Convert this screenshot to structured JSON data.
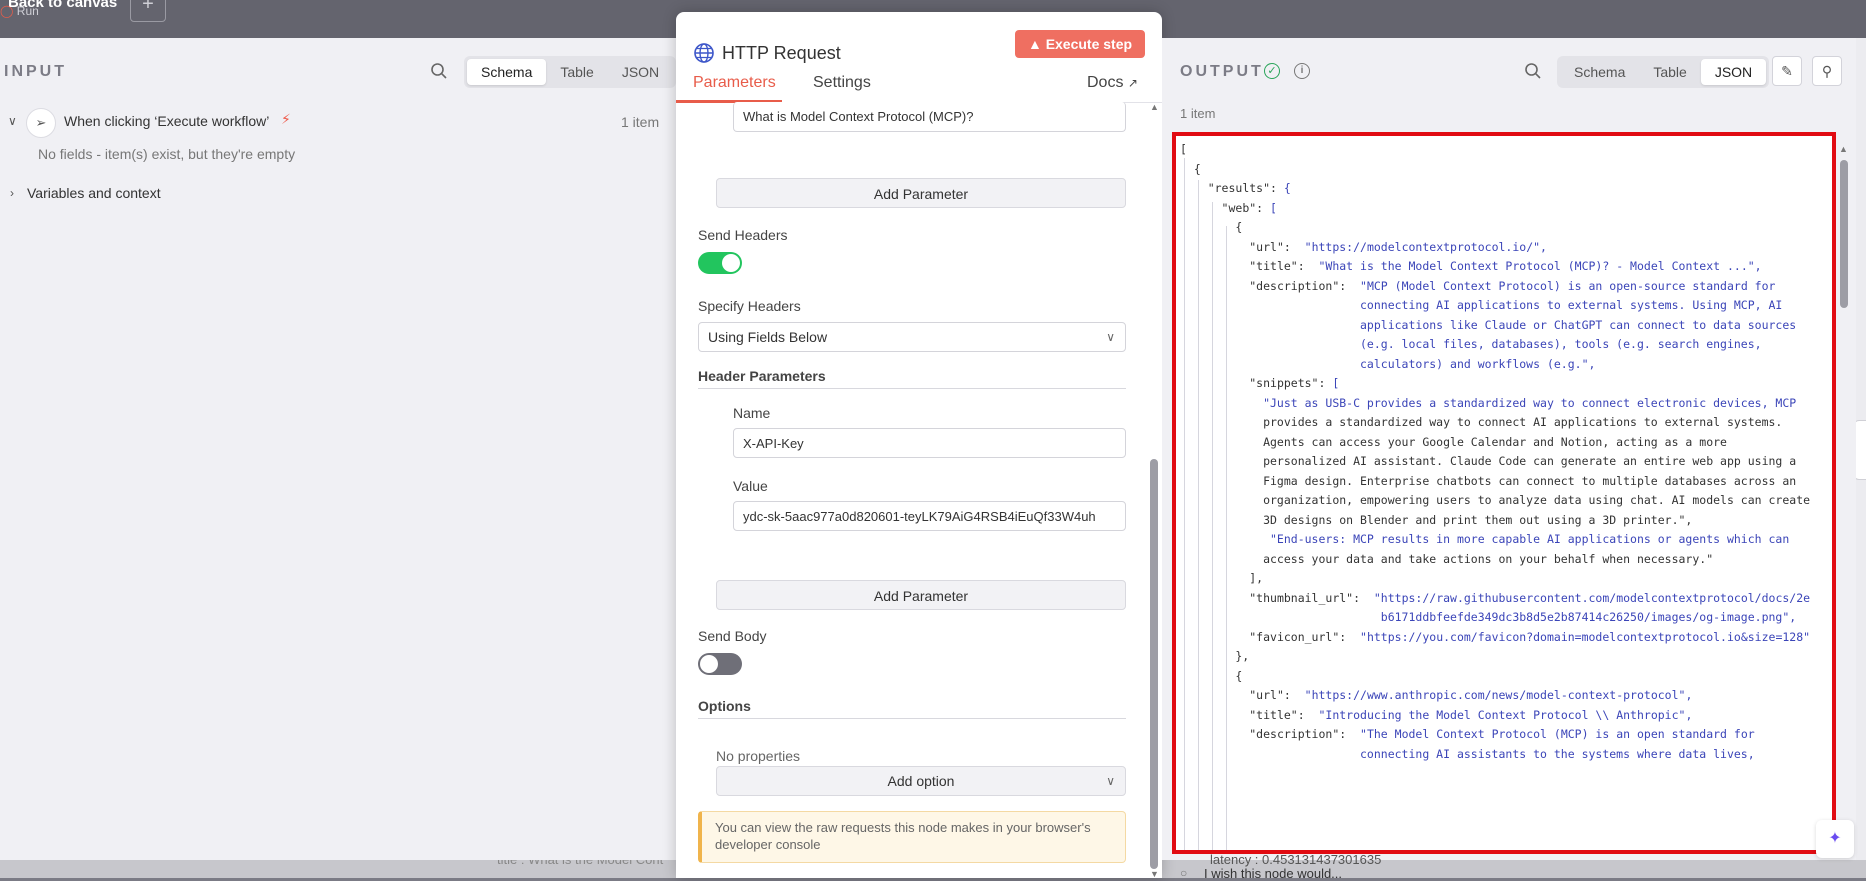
{
  "canvas": {
    "back_label": "Back to canvas",
    "run_label": "Run",
    "plus_label": "+",
    "bottom_text": "title : What is the Model Cont"
  },
  "input": {
    "title": "INPUT",
    "tabs": [
      "Schema",
      "Table",
      "JSON"
    ],
    "active_tab": "Schema",
    "trigger_label": "When clicking ‘Execute workflow’",
    "trigger_count": "1 item",
    "no_fields": "No fields - item(s) exist, but they're empty",
    "variables": "Variables and context"
  },
  "node": {
    "title": "HTTP Request",
    "execute_label": "Execute step",
    "tabs": {
      "parameters": "Parameters",
      "settings": "Settings",
      "docs": "Docs"
    },
    "query_value": "What is Model Context Protocol (MCP)?",
    "add_parameter": "Add Parameter",
    "send_headers_label": "Send Headers",
    "send_headers_on": true,
    "specify_headers_label": "Specify Headers",
    "specify_headers_value": "Using Fields Below",
    "header_params_label": "Header Parameters",
    "name_label": "Name",
    "name_value": "X-API-Key",
    "value_label": "Value",
    "value_value": "ydc-sk-5aac977a0d820601-teyLK79AiG4RSB4iEuQf33W4uh",
    "add_parameter_2": "Add Parameter",
    "send_body_label": "Send Body",
    "send_body_on": false,
    "options_label": "Options",
    "no_properties": "No properties",
    "add_option": "Add option",
    "notice": "You can view the raw requests this node makes in your browser's developer console",
    "accent": "#e85c4a",
    "toggle_on_color": "#22c55e"
  },
  "output": {
    "title": "OUTPUT",
    "tabs": [
      "Schema",
      "Table",
      "JSON"
    ],
    "active_tab": "JSON",
    "count": "1 item",
    "latency": "latency : 0.453131437301635",
    "wish": "I wish this node would...",
    "highlight_color": "#e10b12",
    "json_lines": [
      "[",
      "  {",
      "    \"results\": {",
      "      \"web\": [",
      "        {",
      "          \"url\":  \"https://modelcontextprotocol.io/\",",
      "          \"title\":  \"What is the Model Context Protocol (MCP)? - Model Context ...\",",
      "          \"description\":  \"MCP (Model Context Protocol) is an open-source standard for",
      "                          connecting AI applications to external systems. Using MCP, AI",
      "                          applications like Claude or ChatGPT can connect to data sources",
      "                          (e.g. local files, databases), tools (e.g. search engines,",
      "                          calculators) and workflows (e.g.\",",
      "          \"snippets\": [",
      "            \"Just as USB-C provides a standardized way to connect electronic devices, MCP",
      "            provides a standardized way to connect AI applications to external systems.",
      "            Agents can access your Google Calendar and Notion, acting as a more",
      "            personalized AI assistant. Claude Code can generate an entire web app using a",
      "            Figma design. Enterprise chatbots can connect to multiple databases across an",
      "            organization, empowering users to analyze data using chat. AI models can create",
      "            3D designs on Blender and print them out using a 3D printer.\",",
      "             \"End-users: MCP results in more capable AI applications or agents which can",
      "            access your data and take actions on your behalf when necessary.\"",
      "          ],",
      "          \"thumbnail_url\":  \"https://raw.githubusercontent.com/modelcontextprotocol/docs/2e",
      "                             b6171ddbfeefde349dc3b8d5e2b87414c26250/images/og-image.png\",",
      "          \"favicon_url\":  \"https://you.com/favicon?domain=modelcontextprotocol.io&size=128\"",
      "        },",
      "        {",
      "          \"url\":  \"https://www.anthropic.com/news/model-context-protocol\",",
      "          \"title\":  \"Introducing the Model Context Protocol \\\\ Anthropic\",",
      "          \"description\":  \"The Model Context Protocol (MCP) is an open standard for",
      "                          connecting AI assistants to the systems where data lives,"
    ]
  }
}
